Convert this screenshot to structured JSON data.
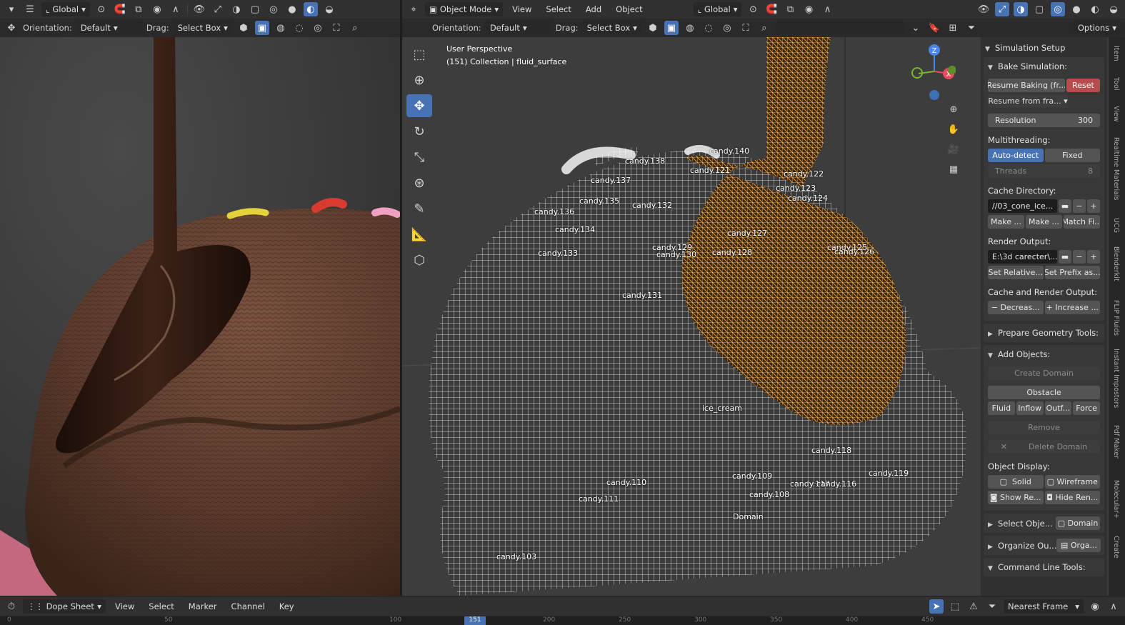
{
  "left_header": {
    "transform_space": "Global",
    "orientation_label": "Orientation:",
    "orientation_value": "Default",
    "drag_label": "Drag:",
    "drag_value": "Select Box"
  },
  "main_header": {
    "mode": "Object Mode",
    "menu": [
      "View",
      "Select",
      "Add",
      "Object"
    ],
    "transform_space": "Global",
    "orientation_label": "Orientation:",
    "orientation_value": "Default",
    "drag_label": "Drag:",
    "drag_value": "Select Box",
    "options_label": "Options"
  },
  "viewport": {
    "view_name": "User Perspective",
    "collection_info": "(151) Collection | fluid_surface"
  },
  "object_labels": [
    "candy.140",
    "candy.138",
    "candy.121",
    "candy.122",
    "candy.137",
    "candy.123",
    "candy.135",
    "candy.132",
    "candy.124",
    "candy.136",
    "candy.134",
    "candy.127",
    "candy.129",
    "candy.130",
    "candy.128",
    "candy.125",
    "candy.126",
    "candy.133",
    "candy.131",
    "ice_cream",
    "candy.118",
    "candy.109",
    "candy.110",
    "candy.117",
    "candy.116",
    "candy.119",
    "candy.111",
    "candy.108",
    "Domain",
    "candy.103"
  ],
  "gizmo": {
    "z": "Z",
    "x": "X"
  },
  "panel": {
    "title": "Simulation Setup",
    "bake_title": "Bake Simulation:",
    "resume_baking": "Resume Baking (fr...",
    "reset": "Reset",
    "resume_from": "Resume from fra...",
    "resolution_label": "Resolution",
    "resolution_value": "300",
    "multithreading_label": "Multithreading:",
    "auto_detect": "Auto-detect",
    "fixed": "Fixed",
    "threads_label": "Threads",
    "threads_value": "8",
    "cache_dir_label": "Cache Directory:",
    "cache_dir_value": "//03_cone_ice...",
    "make1": "Make ...",
    "make2": "Make ...",
    "match": "Match Fi...",
    "render_output_label": "Render Output:",
    "render_output_value": "E:\\3d carecter\\...",
    "set_relative": "Set Relative...",
    "set_prefix": "Set Prefix as...",
    "cache_render_label": "Cache and Render Output:",
    "decrease": "Decreas...",
    "increase": "Increase ...",
    "prepare_geo": "Prepare Geometry Tools:",
    "add_objects": "Add Objects:",
    "create_domain": "Create Domain",
    "obstacle": "Obstacle",
    "fluid": "Fluid",
    "inflow": "Inflow",
    "outflow": "Outf...",
    "force": "Force",
    "remove": "Remove",
    "delete_domain": "Delete Domain",
    "object_display": "Object Display:",
    "solid": "Solid",
    "wireframe": "Wireframe",
    "show_render": "Show Re...",
    "hide_render": "Hide Ren...",
    "select_objects": "Select Obje...",
    "domain_btn": "Domain",
    "organize": "Organize Ou...",
    "organize_btn": "Orga...",
    "command_line": "Command Line Tools:"
  },
  "side_tabs": [
    "Item",
    "Tool",
    "View",
    "Realtime Materials",
    "UCG",
    "Blenderkit",
    "FLIP Fluids",
    "Instant Impostors",
    "Pdf Maker",
    "Molecular+",
    "Create"
  ],
  "dopesheet": {
    "editor": "Dope Sheet",
    "menu": [
      "View",
      "Select",
      "Marker",
      "Channel",
      "Key"
    ],
    "snap": "Nearest Frame",
    "ruler": [
      "0",
      "50",
      "100",
      "151",
      "200",
      "250",
      "300",
      "350",
      "400",
      "450"
    ]
  }
}
